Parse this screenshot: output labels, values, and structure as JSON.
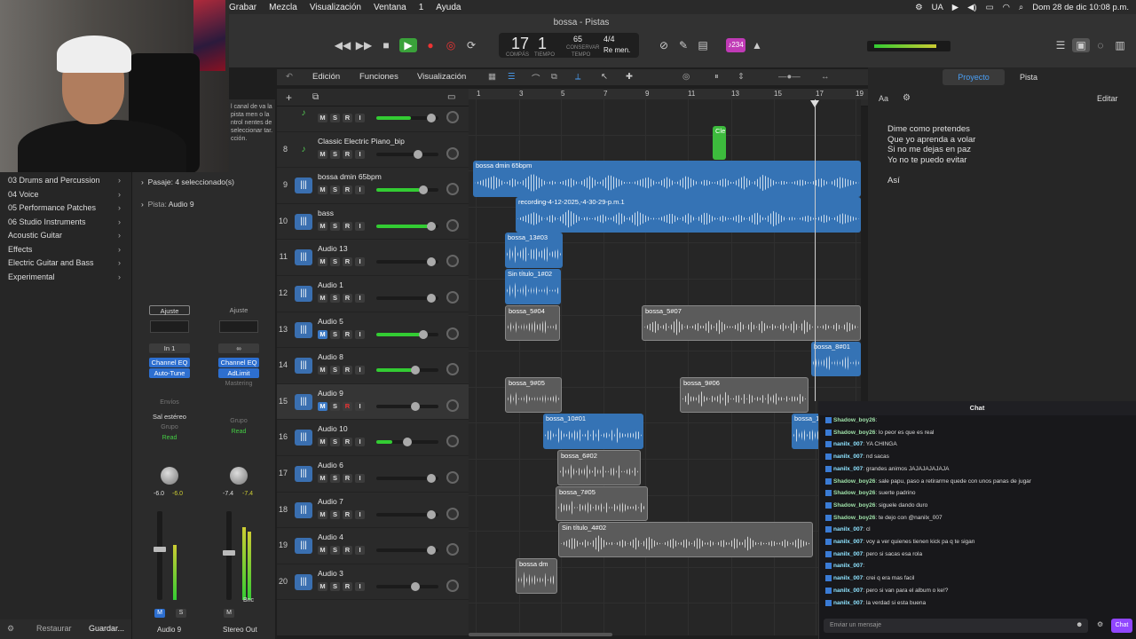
{
  "menubar": {
    "items": [
      "Grabar",
      "Mezcla",
      "Visualización",
      "Ventana",
      "1",
      "Ayuda"
    ],
    "status_lang": "UA",
    "datetime": "Dom 28 de dic  10:08 p.m."
  },
  "window": {
    "title": "bossa - Pistas"
  },
  "control_bar": {
    "bar": "17",
    "beat": "1",
    "bar_label": "COMPÁS",
    "beat_label": "TIEMPO",
    "tempo": "65",
    "tempo_mode": "CONSERVAR",
    "tempo_label": "TEMPO",
    "time_sig": "4/4",
    "key": "Re men.",
    "count_in": "♪234"
  },
  "library": {
    "items": [
      {
        "label": "03 Drums and Percussion",
        "icon": "chevron-right-icon"
      },
      {
        "label": "04 Voice",
        "icon": "chevron-right-icon"
      },
      {
        "label": "05 Performance Patches",
        "icon": "chevron-right-icon"
      },
      {
        "label": "06 Studio Instruments",
        "icon": "chevron-right-icon"
      },
      {
        "label": "Acoustic Guitar",
        "icon": "chevron-right-icon"
      },
      {
        "label": "Effects",
        "icon": "chevron-right-icon"
      },
      {
        "label": "Electric Guitar and Bass",
        "icon": "chevron-right-icon"
      },
      {
        "label": "Experimental",
        "icon": "chevron-right-icon"
      }
    ],
    "restore": "Restaurar",
    "save": "Guardar..."
  },
  "inspector": {
    "help_text": "l canal de va la pista men o la ntrol nentes de seleccionar tar. cción.",
    "region_label": "Pasaje:",
    "region_value": "4 seleccionado(s)",
    "track_label": "Pista:",
    "track_value": "Audio 9",
    "strip1": {
      "setting": "Ajuste",
      "input": "In 1",
      "eq": "Channel EQ",
      "plugin": "Auto-Tune",
      "sends": "Envíos",
      "output": "Sal estéreo",
      "group": "Grupo",
      "automation": "Read",
      "pan_value": "-6.0",
      "peak_value": "-6.0",
      "mute": "M",
      "solo": "S",
      "name": "Audio 9"
    },
    "strip2": {
      "setting": "Ajuste",
      "eq": "Channel EQ",
      "plugin": "AdLimit",
      "mastering": "Mastering",
      "group": "Grupo",
      "automation": "Read",
      "pan_value": "-7.4",
      "peak_value": "-7.4",
      "mute": "M",
      "bounce": "Bnc",
      "name": "Stereo Out"
    }
  },
  "tracks_toolbar": {
    "edit": "Edición",
    "functions": "Funciones",
    "view": "Visualización"
  },
  "ruler": [
    "1",
    "3",
    "5",
    "7",
    "9",
    "11",
    "13",
    "15",
    "17",
    "19"
  ],
  "tracks": [
    {
      "num": "",
      "name": "",
      "type": "midi",
      "mute": false,
      "rec": false
    },
    {
      "num": "8",
      "name": "Classic Electric Piano_bip",
      "type": "midi",
      "mute": false,
      "rec": false
    },
    {
      "num": "9",
      "name": "bossa dmin 65bpm",
      "type": "audio",
      "mute": false,
      "rec": false
    },
    {
      "num": "10",
      "name": "bass",
      "type": "audio",
      "mute": false,
      "rec": false
    },
    {
      "num": "11",
      "name": "Audio 13",
      "type": "audio",
      "mute": false,
      "rec": false
    },
    {
      "num": "12",
      "name": "Audio 1",
      "type": "audio",
      "mute": false,
      "rec": false
    },
    {
      "num": "13",
      "name": "Audio 5",
      "type": "audio",
      "mute": true,
      "rec": false
    },
    {
      "num": "14",
      "name": "Audio 8",
      "type": "audio",
      "mute": false,
      "rec": false
    },
    {
      "num": "15",
      "name": "Audio 9",
      "type": "audio",
      "mute": true,
      "rec": true
    },
    {
      "num": "16",
      "name": "Audio 10",
      "type": "audio",
      "mute": false,
      "rec": false
    },
    {
      "num": "17",
      "name": "Audio 6",
      "type": "audio",
      "mute": false,
      "rec": false
    },
    {
      "num": "18",
      "name": "Audio 7",
      "type": "audio",
      "mute": false,
      "rec": false
    },
    {
      "num": "19",
      "name": "Audio 4",
      "type": "audio",
      "mute": false,
      "rec": false
    },
    {
      "num": "20",
      "name": "Audio 3",
      "type": "audio",
      "mute": false,
      "rec": false
    }
  ],
  "button_labels": {
    "mute": "M",
    "solo": "S",
    "record": "R",
    "input": "I"
  },
  "regions": [
    {
      "lane": 0,
      "label": "",
      "kind": "green"
    },
    {
      "lane": 1,
      "label": "Cle",
      "kind": "green"
    },
    {
      "lane": 2,
      "label": "bossa dmin 65bpm",
      "kind": "blue"
    },
    {
      "lane": 3,
      "label": "recording-4-12-2025,-4-30-29-p.m.1",
      "kind": "blue"
    },
    {
      "lane": 4,
      "label": "bossa_13#03",
      "kind": "blue"
    },
    {
      "lane": 5,
      "label": "Sin título_1#02",
      "kind": "blue"
    },
    {
      "lane": 6,
      "label": "bossa_5#04",
      "kind": "gray"
    },
    {
      "lane": 6,
      "label": "bossa_5#07",
      "kind": "gray"
    },
    {
      "lane": 7,
      "label": "bossa_8#01",
      "kind": "blue"
    },
    {
      "lane": 8,
      "label": "bossa_9#05",
      "kind": "gray"
    },
    {
      "lane": 8,
      "label": "bossa_9#06",
      "kind": "gray"
    },
    {
      "lane": 9,
      "label": "bossa_10#01",
      "kind": "blue"
    },
    {
      "lane": 9,
      "label": "bossa_1",
      "kind": "blue"
    },
    {
      "lane": 10,
      "label": "bossa_6#02",
      "kind": "gray"
    },
    {
      "lane": 11,
      "label": "bossa_7#05",
      "kind": "gray"
    },
    {
      "lane": 12,
      "label": "Sin título_4#02",
      "kind": "gray"
    },
    {
      "lane": 13,
      "label": "bossa dm",
      "kind": "gray"
    }
  ],
  "notes": {
    "tab_project": "Proyecto",
    "tab_track": "Pista",
    "font_btn": "Aa",
    "edit": "Editar",
    "lines": [
      "Dime como pretendes",
      "Que yo aprenda a volar",
      "Si no me dejas en paz",
      "Yo no te puedo evitar",
      "",
      "Así"
    ]
  },
  "chat": {
    "title": "Chat",
    "messages": [
      {
        "user": "Shadow_boy26",
        "text": ""
      },
      {
        "user": "Shadow_boy26",
        "text": "lo peor es que es real"
      },
      {
        "user": "nanilx_007",
        "text": "YA CHINGA"
      },
      {
        "user": "nanilx_007",
        "text": "nd sacas"
      },
      {
        "user": "nanilx_007",
        "text": "grandes animos JAJAJAJAJAJA"
      },
      {
        "user": "Shadow_boy26",
        "text": "sale papu, paso a retirarme quede con unos panas de jugar"
      },
      {
        "user": "Shadow_boy26",
        "text": "suerte padrino"
      },
      {
        "user": "Shadow_boy26",
        "text": "siguele dando duro"
      },
      {
        "user": "Shadow_boy26",
        "text": "te dejo con @nanilx_007"
      },
      {
        "user": "nanilx_007",
        "text": "cl"
      },
      {
        "user": "nanilx_007",
        "text": "voy a ver quienes tienen kick pa q te sigan"
      },
      {
        "user": "nanilx_007",
        "text": "pero si sacas esa rola"
      },
      {
        "user": "nanilx_007",
        "text": ""
      },
      {
        "user": "nanilx_007",
        "text": "crei q era mas facil"
      },
      {
        "user": "nanilx_007",
        "text": "pero si van para el album o ke!?"
      },
      {
        "user": "nanilx_007",
        "text": "la verdad si esta buena"
      }
    ],
    "input_placeholder": "Enviar un mensaje",
    "send": "Chat"
  }
}
